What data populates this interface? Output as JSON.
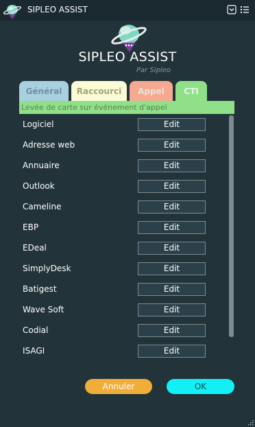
{
  "window": {
    "title": "SIPLEO ASSIST"
  },
  "header": {
    "app_name": "SIPLEO ASSIST",
    "subtitle": "Par Sipleo"
  },
  "tabs": [
    {
      "label": "Général",
      "color": "#a9d0df"
    },
    {
      "label": "Raccourci",
      "color": "#fbfcd5"
    },
    {
      "label": "Appel",
      "color": "#f4a990"
    },
    {
      "label": "CTI",
      "color": "#90e08a",
      "selected": true
    }
  ],
  "banner": {
    "text": "Levée de carte sur événement d'appel",
    "color": "#90e08a"
  },
  "rows": [
    {
      "label": "Logiciel",
      "button": "Edit"
    },
    {
      "label": "Adresse web",
      "button": "Edit"
    },
    {
      "label": "Annuaire",
      "button": "Edit"
    },
    {
      "label": "Outlook",
      "button": "Edit"
    },
    {
      "label": "Cameline",
      "button": "Edit"
    },
    {
      "label": "EBP",
      "button": "Edit"
    },
    {
      "label": "EDeal",
      "button": "Edit"
    },
    {
      "label": "SimplyDesk",
      "button": "Edit"
    },
    {
      "label": "Batigest",
      "button": "Edit"
    },
    {
      "label": "Wave Soft",
      "button": "Edit"
    },
    {
      "label": "Codial",
      "button": "Edit"
    },
    {
      "label": "ISAGI",
      "button": "Edit"
    }
  ],
  "footer": {
    "cancel_label": "Annuler",
    "ok_label": "OK"
  },
  "icons": {
    "app_logo": "sipleo-planet-logo-icon",
    "dropdown": "chevron-down-icon",
    "menu": "menu-list-icon",
    "resize": "resize-grip-icon"
  },
  "colors": {
    "background": "#22333a",
    "cancel": "#f1ad3a",
    "ok": "#12f0f5"
  }
}
